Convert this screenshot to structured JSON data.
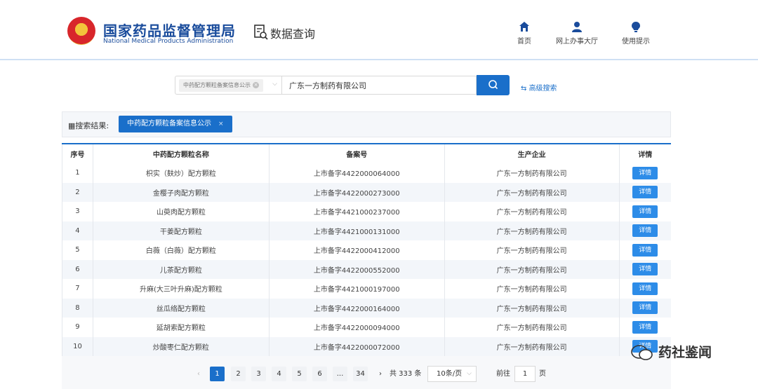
{
  "header": {
    "title_cn": "国家药品监督管理局",
    "title_en": "National Medical Products Administration",
    "query_label": "数据查询",
    "nav": [
      {
        "label": "首页",
        "icon": "home-icon"
      },
      {
        "label": "网上办事大厅",
        "icon": "user-icon"
      },
      {
        "label": "使用提示",
        "icon": "tip-icon"
      }
    ]
  },
  "search": {
    "category_tag": "中药配方颗粒备案信息公示",
    "value": "广东一方制药有限公司",
    "advanced_label": "高级搜索"
  },
  "results": {
    "label": "搜索结果:",
    "tab": "中药配方颗粒备案信息公示",
    "columns": [
      "序号",
      "中药配方颗粒名称",
      "备案号",
      "生产企业",
      "详情"
    ],
    "rows": [
      {
        "no": "1",
        "name": "枳实（麸炒）配方颗粒",
        "record": "上市备字4422000064000",
        "company": "广东一方制药有限公司",
        "detail": "详情"
      },
      {
        "no": "2",
        "name": "金樱子肉配方颗粒",
        "record": "上市备字4422000273000",
        "company": "广东一方制药有限公司",
        "detail": "详情"
      },
      {
        "no": "3",
        "name": "山萸肉配方颗粒",
        "record": "上市备字4421000237000",
        "company": "广东一方制药有限公司",
        "detail": "详情"
      },
      {
        "no": "4",
        "name": "干姜配方颗粒",
        "record": "上市备字4421000131000",
        "company": "广东一方制药有限公司",
        "detail": "详情"
      },
      {
        "no": "5",
        "name": "白薇（白薇）配方颗粒",
        "record": "上市备字4422000412000",
        "company": "广东一方制药有限公司",
        "detail": "详情"
      },
      {
        "no": "6",
        "name": "儿茶配方颗粒",
        "record": "上市备字4422000552000",
        "company": "广东一方制药有限公司",
        "detail": "详情"
      },
      {
        "no": "7",
        "name": "升麻(大三叶升麻)配方颗粒",
        "record": "上市备字4421000197000",
        "company": "广东一方制药有限公司",
        "detail": "详情"
      },
      {
        "no": "8",
        "name": "丝瓜络配方颗粒",
        "record": "上市备字4422000164000",
        "company": "广东一方制药有限公司",
        "detail": "详情"
      },
      {
        "no": "9",
        "name": "延胡索配方颗粒",
        "record": "上市备字4422000094000",
        "company": "广东一方制药有限公司",
        "detail": "详情"
      },
      {
        "no": "10",
        "name": "炒酸枣仁配方颗粒",
        "record": "上市备字4422000072000",
        "company": "广东一方制药有限公司",
        "detail": "详情"
      }
    ]
  },
  "pagination": {
    "pages": [
      "1",
      "2",
      "3",
      "4",
      "5",
      "6",
      "...",
      "34"
    ],
    "current": "1",
    "total": "共 333 条",
    "page_size": "10条/页",
    "goto_label": "前往",
    "goto_value": "1",
    "page_suffix": "页"
  },
  "watermark": {
    "text": "药社鉴闻"
  },
  "colors": {
    "primary": "#1a6fca",
    "brand": "#1a4c9c",
    "detail_button": "#2d8ce8"
  }
}
